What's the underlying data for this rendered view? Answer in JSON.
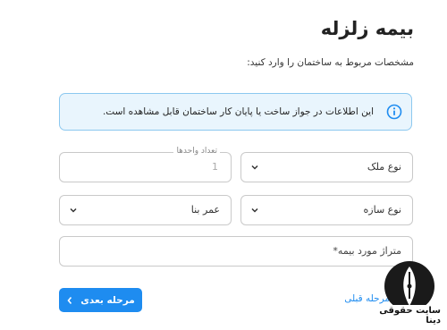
{
  "page": {
    "title": "بیمه زلزله",
    "subtitle": "مشخصات مربوط به ساختمان را وارد کنید:"
  },
  "info": {
    "text": "این اطلاعات در جواز ساخت یا پایان کار ساختمان قابل مشاهده است."
  },
  "form": {
    "property_type": {
      "value": "نوع ملک"
    },
    "unit_count": {
      "label": "تعداد واحدها",
      "value": "1"
    },
    "structure_type": {
      "value": "نوع سازه"
    },
    "building_age": {
      "value": "عمر بنا"
    },
    "insured_area": {
      "value": "متراژ مورد بیمه*"
    }
  },
  "nav": {
    "next_label": "مرحله بعدی",
    "prev_label": "مرحله قبلی"
  },
  "watermark": {
    "text": "سایت حقوقی دینا"
  },
  "colors": {
    "accent": "#1e8cf0",
    "info_bg": "#e9f5fd",
    "info_border": "#8cc8ef"
  }
}
